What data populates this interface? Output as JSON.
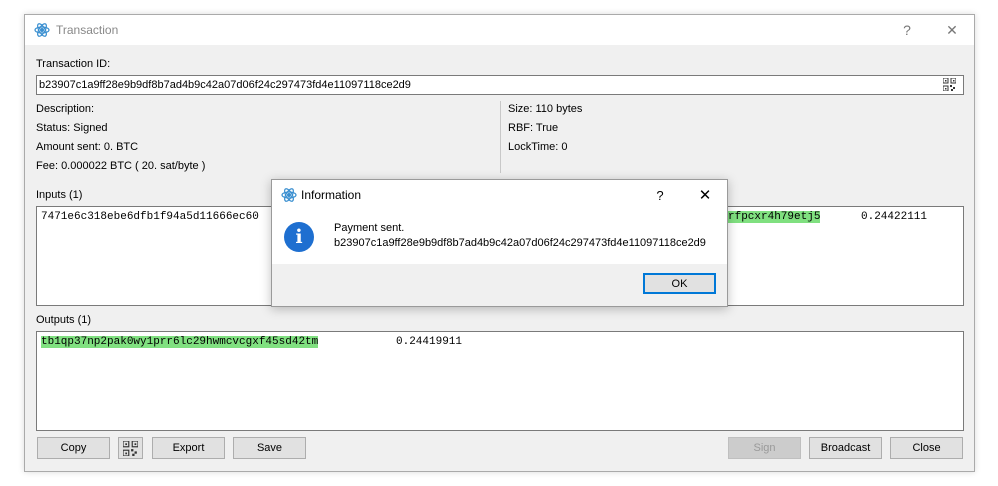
{
  "window": {
    "title": "Transaction",
    "help_label": "?",
    "close_label": "✕"
  },
  "txid": {
    "label": "Transaction ID:",
    "value": "b23907c1a9ff28e9b9df8b7ad4b9c42a07d06f24c297473fd4e11097118ce2d9"
  },
  "details_left": {
    "description": "Description:",
    "status": "Status: Signed",
    "amount": "Amount sent: 0. BTC",
    "fee": "Fee: 0.000022 BTC  ( 20. sat/byte )"
  },
  "details_right": {
    "size": "Size: 110 bytes",
    "rbf": "RBF: True",
    "locktime": "LockTime: 0"
  },
  "inputs": {
    "label": "Inputs (1)",
    "rows": [
      {
        "prevout": "7471e6c318ebe6dfb1f94a5d11666ec60",
        "address_tail": "rfpcxr4h79etj5",
        "amount": "0.24422111"
      }
    ]
  },
  "outputs": {
    "label": "Outputs (1)",
    "rows": [
      {
        "address": "tb1qp37np2pak0wy1prr6lc29hwmcvcgxf45sd42tm",
        "amount": "0.24419911"
      }
    ]
  },
  "buttons": {
    "copy": "Copy",
    "export": "Export",
    "save": "Save",
    "sign": "Sign",
    "broadcast": "Broadcast",
    "close": "Close"
  },
  "dialog": {
    "title": "Information",
    "help_label": "?",
    "close_label": "✕",
    "message_line1": "Payment sent.",
    "message_line2": "b23907c1a9ff28e9b9df8b7ad4b9c42a07d06f24c297473fd4e11097118ce2d9",
    "ok_label": "OK"
  },
  "icons": {
    "app": "electrum-icon",
    "qr": "qr-code-icon",
    "info": "information-icon"
  },
  "colors": {
    "address_highlight": "#80e080",
    "info_blue": "#1e6fd0",
    "focus_blue": "#0078d7"
  }
}
